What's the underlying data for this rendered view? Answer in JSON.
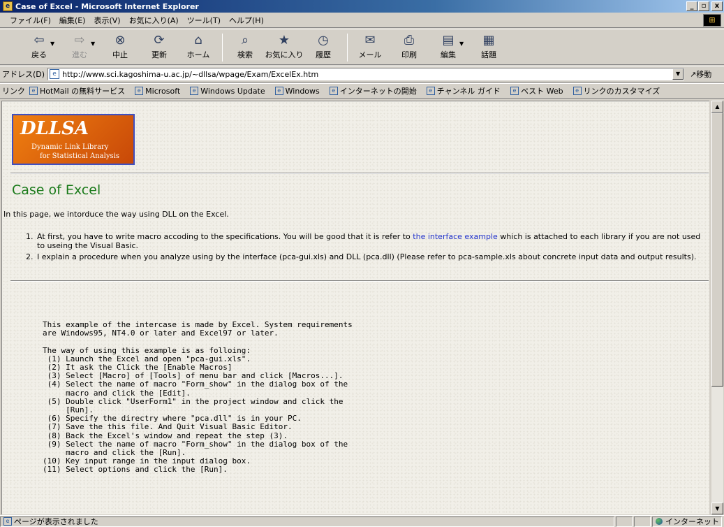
{
  "window": {
    "title": "Case of Excel - Microsoft Internet Explorer",
    "controls": [
      "_",
      "▫",
      "x"
    ]
  },
  "menu": {
    "items": [
      "ファイル(F)",
      "編集(E)",
      "表示(V)",
      "お気に入り(A)",
      "ツール(T)",
      "ヘルプ(H)"
    ]
  },
  "toolbar": {
    "back": "戻る",
    "forward": "進む",
    "stop": "中止",
    "refresh": "更新",
    "home": "ホーム",
    "search": "検索",
    "favorites": "お気に入り",
    "history": "履歴",
    "mail": "メール",
    "print": "印刷",
    "edit": "編集",
    "discuss": "話題"
  },
  "address": {
    "label": "アドレス(D)",
    "url": "http://www.sci.kagoshima-u.ac.jp/~dllsa/wpage/Exam/ExcelEx.htm",
    "go": "移動"
  },
  "links": {
    "label": "リンク",
    "items": [
      "HotMail の無料サービス",
      "Microsoft",
      "Windows Update",
      "Windows",
      "インターネットの開始",
      "チャンネル ガイド",
      "ベスト Web",
      "リンクのカスタマイズ"
    ]
  },
  "page": {
    "logo": {
      "title": "DLLSA",
      "line1": "Dynamic Link Library",
      "line2": "for Statistical Analysis"
    },
    "heading": "Case of Excel",
    "intro": "In this page, we intorduce the way using DLL on the Excel.",
    "steps": [
      {
        "num": "1.",
        "before": "At first, you have to write macro accoding to the specifications. You will be good that it is refer to ",
        "link": "the interface example",
        "after": " which is attached to each library if you are not used to useing the Visual Basic."
      },
      {
        "num": "2.",
        "text": "I explain a procedure when you analyze using by the interface (pca-gui.xls) and DLL (pca.dll) (Please refer to pca-sample.xls about concrete input data and output results)."
      }
    ],
    "preformatted": "This example of the intercase is made by Excel. System requirements\nare Windows95, NT4.0 or later and Excel97 or later.\n\nThe way of using this example is as folloing:\n (1) Launch the Excel and open \"pca-gui.xls\".\n (2) It ask the Click the [Enable Macros]\n (3) Select [Macro] of [Tools] of menu bar and click [Macros...].\n (4) Select the name of macro \"Form_show\" in the dialog box of the\n     macro and click the [Edit].\n (5) Double click \"UserForm1\" in the project window and click the\n     [Run].\n (6) Specify the directry where \"pca.dll\" is in your PC.\n (7) Save the this file. And Quit Visual Basic Editor.\n (8) Back the Excel's window and repeat the step (3).\n (9) Select the name of macro \"Form_show\" in the dialog box of the\n     macro and click the [Run].\n(10) Key input range in the input dialog box.\n(11) Select options and click the [Run]."
  },
  "status": {
    "text": "ページが表示されました",
    "zone": "インターネット"
  }
}
